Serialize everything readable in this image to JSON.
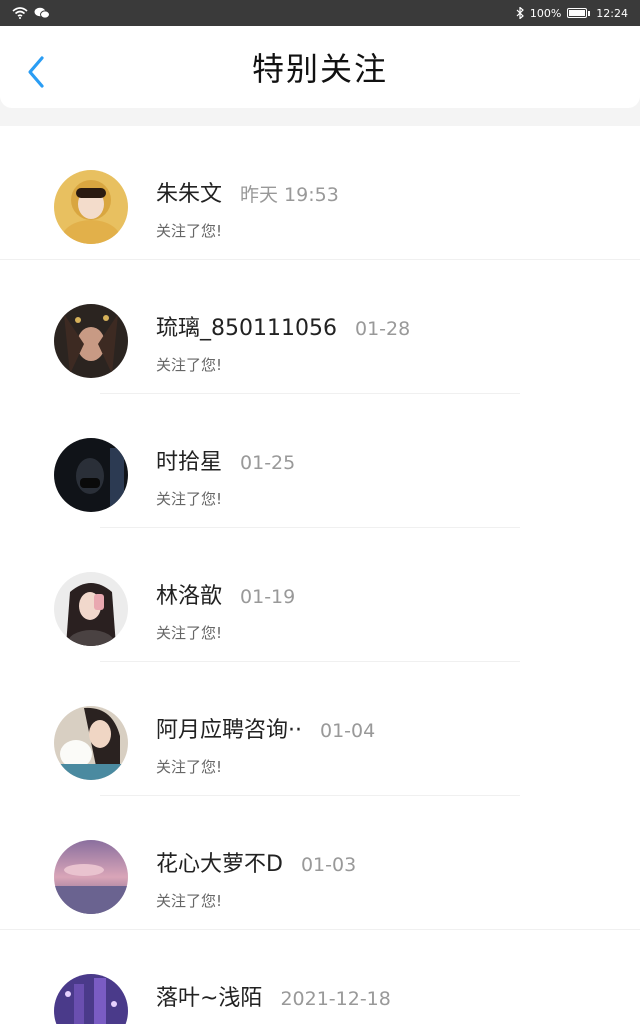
{
  "status_bar": {
    "battery": "100%",
    "time": "12:24"
  },
  "header": {
    "title": "特别关注"
  },
  "items": [
    {
      "name": "朱朱文",
      "time": "昨天 19:53",
      "subtitle": "关注了您!"
    },
    {
      "name": "琉璃_850111056",
      "time": "01-28",
      "subtitle": "关注了您!"
    },
    {
      "name": "时拾星",
      "time": "01-25",
      "subtitle": "关注了您!"
    },
    {
      "name": "林洛歆",
      "time": "01-19",
      "subtitle": "关注了您!"
    },
    {
      "name": "阿月应聘咨询··",
      "time": "01-04",
      "subtitle": "关注了您!"
    },
    {
      "name": "花心大萝不D",
      "time": "01-03",
      "subtitle": "关注了您!"
    },
    {
      "name": "落叶~浅陌",
      "time": "2021-12-18",
      "subtitle": ""
    }
  ],
  "colors": {
    "accent": "#2a9df4",
    "status_bar": "#3a3a3a"
  }
}
